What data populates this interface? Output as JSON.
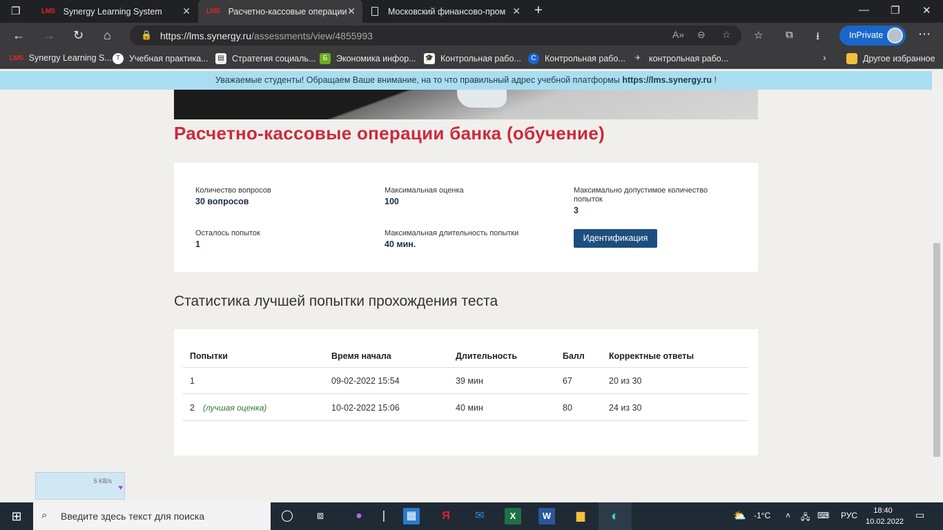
{
  "browser": {
    "tabs": [
      {
        "title": "Synergy Learning System",
        "icon": "lms-logo",
        "active": false
      },
      {
        "title": "Расчетно-кассовые операции б",
        "icon": "lms-logo",
        "active": true
      },
      {
        "title": "Московский финансово-промь",
        "icon": "document-icon",
        "active": false
      }
    ],
    "lms_logo_text": "LMS",
    "url_host": "https://lms.synergy.ru",
    "url_path": "/assessments/view/4855993",
    "inprivate_label": "InPrivate",
    "favorites": [
      {
        "label": "Synergy Learning S...",
        "icon": "lms-logo"
      },
      {
        "label": "Учебная практика...",
        "icon": "globe-icon"
      },
      {
        "label": "Стратегия социаль...",
        "icon": "document-icon"
      },
      {
        "label": "Экономика инфор...",
        "icon": "b-icon"
      },
      {
        "label": "Контрольная рабо...",
        "icon": "graduation-cap-icon"
      },
      {
        "label": "Контрольная рабо...",
        "icon": "c-icon"
      },
      {
        "label": "контрольная рабо...",
        "icon": "bird-icon"
      }
    ],
    "other_favorites": "Другое избранное"
  },
  "notice": {
    "text": "Уважаемые студенты! Обращаем Ваше внимание, на то что правильный адрес учебной платформы",
    "link": "https://lms.synergy.ru",
    "suffix": "!"
  },
  "page": {
    "title": "Расчетно-кассовые операции банка (обучение)",
    "info": {
      "questions_label": "Количество вопросов",
      "questions_value": "30 вопросов",
      "max_score_label": "Максимальная оценка",
      "max_score_value": "100",
      "max_attempts_label": "Максимально допустимое количество попыток",
      "max_attempts_value": "3",
      "attempts_left_label": "Осталось попыток",
      "attempts_left_value": "1",
      "max_duration_label": "Максимальная длительность попытки",
      "max_duration_value": "40 мин.",
      "identify_button": "Идентификация"
    },
    "stats_title": "Статистика лучшей попытки прохождения теста",
    "table": {
      "headers": [
        "Попытки",
        "Время начала",
        "Длительность",
        "Балл",
        "Корректные ответы"
      ],
      "rows": [
        {
          "attempt": "1",
          "note": "",
          "start": "09-02-2022 15:54",
          "duration": "39 мин",
          "score": "67",
          "correct": "20 из 30"
        },
        {
          "attempt": "2",
          "note": "(лучшая оценка)",
          "start": "10-02-2022 15:06",
          "duration": "40 мин",
          "score": "80",
          "correct": "24 из 30"
        }
      ]
    }
  },
  "net_widget": {
    "rate": "5 KB/s"
  },
  "taskbar": {
    "search_placeholder": "Введите здесь текст для поиска",
    "weather": "-1°C",
    "lang": "РУС",
    "time": "18:40",
    "date": "10.02.2022"
  },
  "colors": {
    "accent_red": "#cc2a3c",
    "button_blue": "#1d4e80",
    "notice_blue": "#a9ddf0",
    "best_green": "#2c7a2c"
  }
}
